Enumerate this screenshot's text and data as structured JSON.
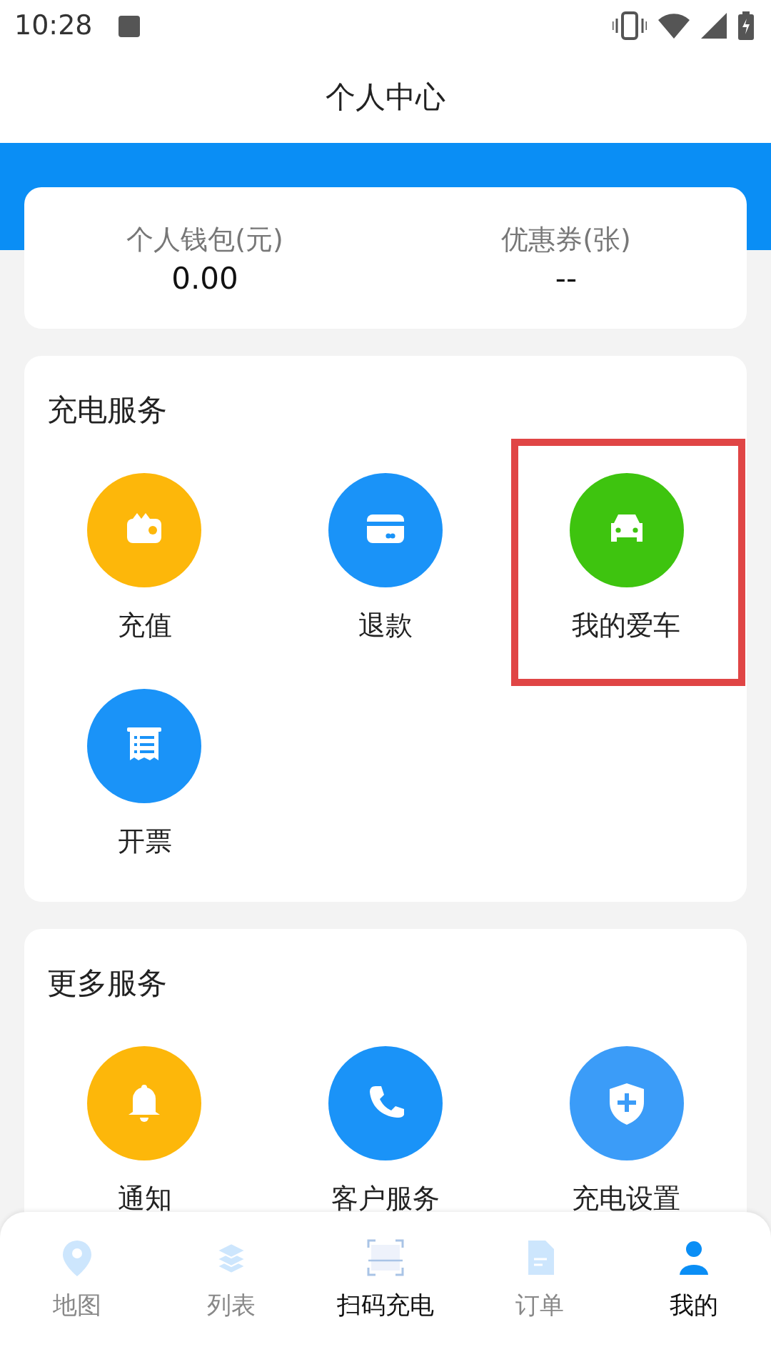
{
  "status_bar": {
    "time": "10:28"
  },
  "header": {
    "title": "个人中心"
  },
  "wallet": [
    {
      "label": "个人钱包(元)",
      "value": "0.00"
    },
    {
      "label": "优惠券(张)",
      "value": "--"
    }
  ],
  "sections": [
    {
      "title": "充电服务",
      "items": [
        {
          "label": "充值",
          "kind": "wallet",
          "color": "#fdb70a",
          "highlighted": false
        },
        {
          "label": "退款",
          "kind": "card",
          "color": "#1a93f8",
          "highlighted": false
        },
        {
          "label": "我的爱车",
          "kind": "car",
          "color": "#3ec40f",
          "highlighted": true
        },
        {
          "label": "开票",
          "kind": "receipt",
          "color": "#1a93f8",
          "highlighted": false
        }
      ]
    },
    {
      "title": "更多服务",
      "items": [
        {
          "label": "通知",
          "kind": "bell",
          "color": "#fdb70a",
          "highlighted": false
        },
        {
          "label": "客户服务",
          "kind": "phone",
          "color": "#1a93f8",
          "highlighted": false
        },
        {
          "label": "充电设置",
          "kind": "shield",
          "color": "#3b9cf8",
          "highlighted": false
        }
      ]
    }
  ],
  "nav": [
    {
      "label": "地图",
      "kind": "pin",
      "selected": false
    },
    {
      "label": "列表",
      "kind": "layers",
      "selected": false
    },
    {
      "label": "扫码充电",
      "kind": "scan",
      "selected": false
    },
    {
      "label": "订单",
      "kind": "doc",
      "selected": false
    },
    {
      "label": "我的",
      "kind": "user",
      "selected": true
    }
  ]
}
